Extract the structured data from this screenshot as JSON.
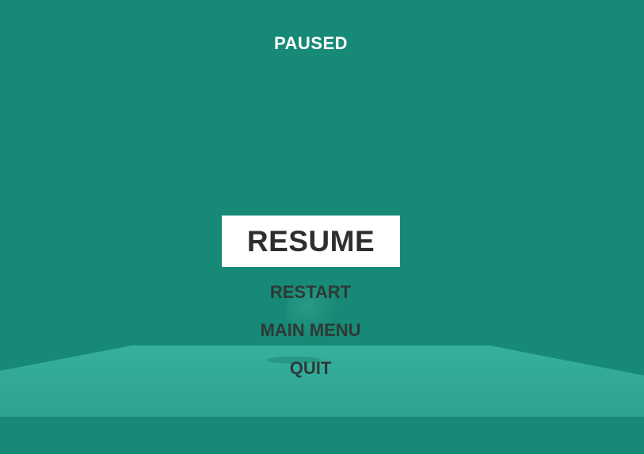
{
  "title": "PAUSED",
  "menu": {
    "items": [
      {
        "label": "RESUME",
        "selected": true
      },
      {
        "label": "RESTART",
        "selected": false
      },
      {
        "label": "MAIN MENU",
        "selected": false
      },
      {
        "label": "QUIT",
        "selected": false
      }
    ]
  },
  "colors": {
    "background": "#168a76",
    "floor": "#2fa896",
    "selected_bg": "#ffffff",
    "menu_text": "#2f3836",
    "title_text": "#ffffff"
  }
}
